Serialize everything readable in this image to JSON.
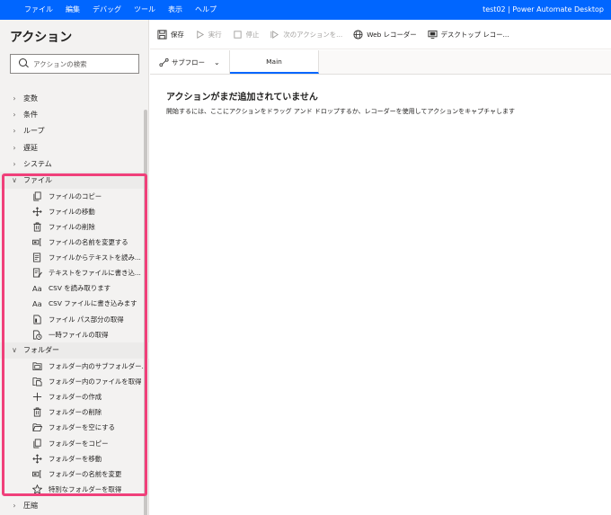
{
  "menubar": {
    "items": [
      "ファイル",
      "編集",
      "デバッグ",
      "ツール",
      "表示",
      "ヘルプ"
    ],
    "window_title": "test02 | Power Automate Desktop"
  },
  "panel": {
    "title": "アクション",
    "search_placeholder": "アクションの検索"
  },
  "groups_top": [
    {
      "label": "変数",
      "expanded": false
    },
    {
      "label": "条件",
      "expanded": false
    },
    {
      "label": "ループ",
      "expanded": false
    },
    {
      "label": "遅延",
      "expanded": false
    },
    {
      "label": "システム",
      "expanded": false
    }
  ],
  "file_group": {
    "label": "ファイル",
    "expanded": true,
    "items": [
      {
        "label": "ファイルのコピー",
        "icon": "copy-icon"
      },
      {
        "label": "ファイルの移動",
        "icon": "move-icon"
      },
      {
        "label": "ファイルの削除",
        "icon": "trash-icon"
      },
      {
        "label": "ファイルの名前を変更する",
        "icon": "rename-icon"
      },
      {
        "label": "ファイルからテキストを読み...",
        "icon": "read-text-icon"
      },
      {
        "label": "テキストをファイルに書き込...",
        "icon": "write-text-icon"
      },
      {
        "label": "CSV を読み取ります",
        "icon": "text-aa-icon"
      },
      {
        "label": "CSV ファイルに書き込みます",
        "icon": "text-aa-icon"
      },
      {
        "label": "ファイル パス部分の取得",
        "icon": "file-path-icon"
      },
      {
        "label": "一時ファイルの取得",
        "icon": "temp-file-icon"
      }
    ]
  },
  "folder_group": {
    "label": "フォルダー",
    "expanded": true,
    "items": [
      {
        "label": "フォルダー内のサブフォルダー...",
        "icon": "subfolder-icon"
      },
      {
        "label": "フォルダー内のファイルを取得",
        "icon": "folder-files-icon"
      },
      {
        "label": "フォルダーの作成",
        "icon": "plus-icon"
      },
      {
        "label": "フォルダーの削除",
        "icon": "trash-icon"
      },
      {
        "label": "フォルダーを空にする",
        "icon": "empty-folder-icon"
      },
      {
        "label": "フォルダーをコピー",
        "icon": "copy-icon"
      },
      {
        "label": "フォルダーを移動",
        "icon": "move-icon"
      },
      {
        "label": "フォルダーの名前を変更",
        "icon": "rename-icon"
      },
      {
        "label": "特別なフォルダーを取得",
        "icon": "star-icon"
      }
    ]
  },
  "groups_bottom": [
    {
      "label": "圧縮",
      "expanded": false
    }
  ],
  "toolbar": {
    "save": "保存",
    "run": "実行",
    "stop": "停止",
    "next_action": "次のアクションを...",
    "web_recorder": "Web レコーダー",
    "desktop_recorder": "デスクトップ レコー..."
  },
  "tabs": {
    "subflow": "サブフロー",
    "main": "Main"
  },
  "empty_state": {
    "title": "アクションがまだ追加されていません",
    "description": "開始するには、ここにアクションをドラッグ アンド ドロップするか、レコーダーを使用してアクションをキャプチャします"
  }
}
